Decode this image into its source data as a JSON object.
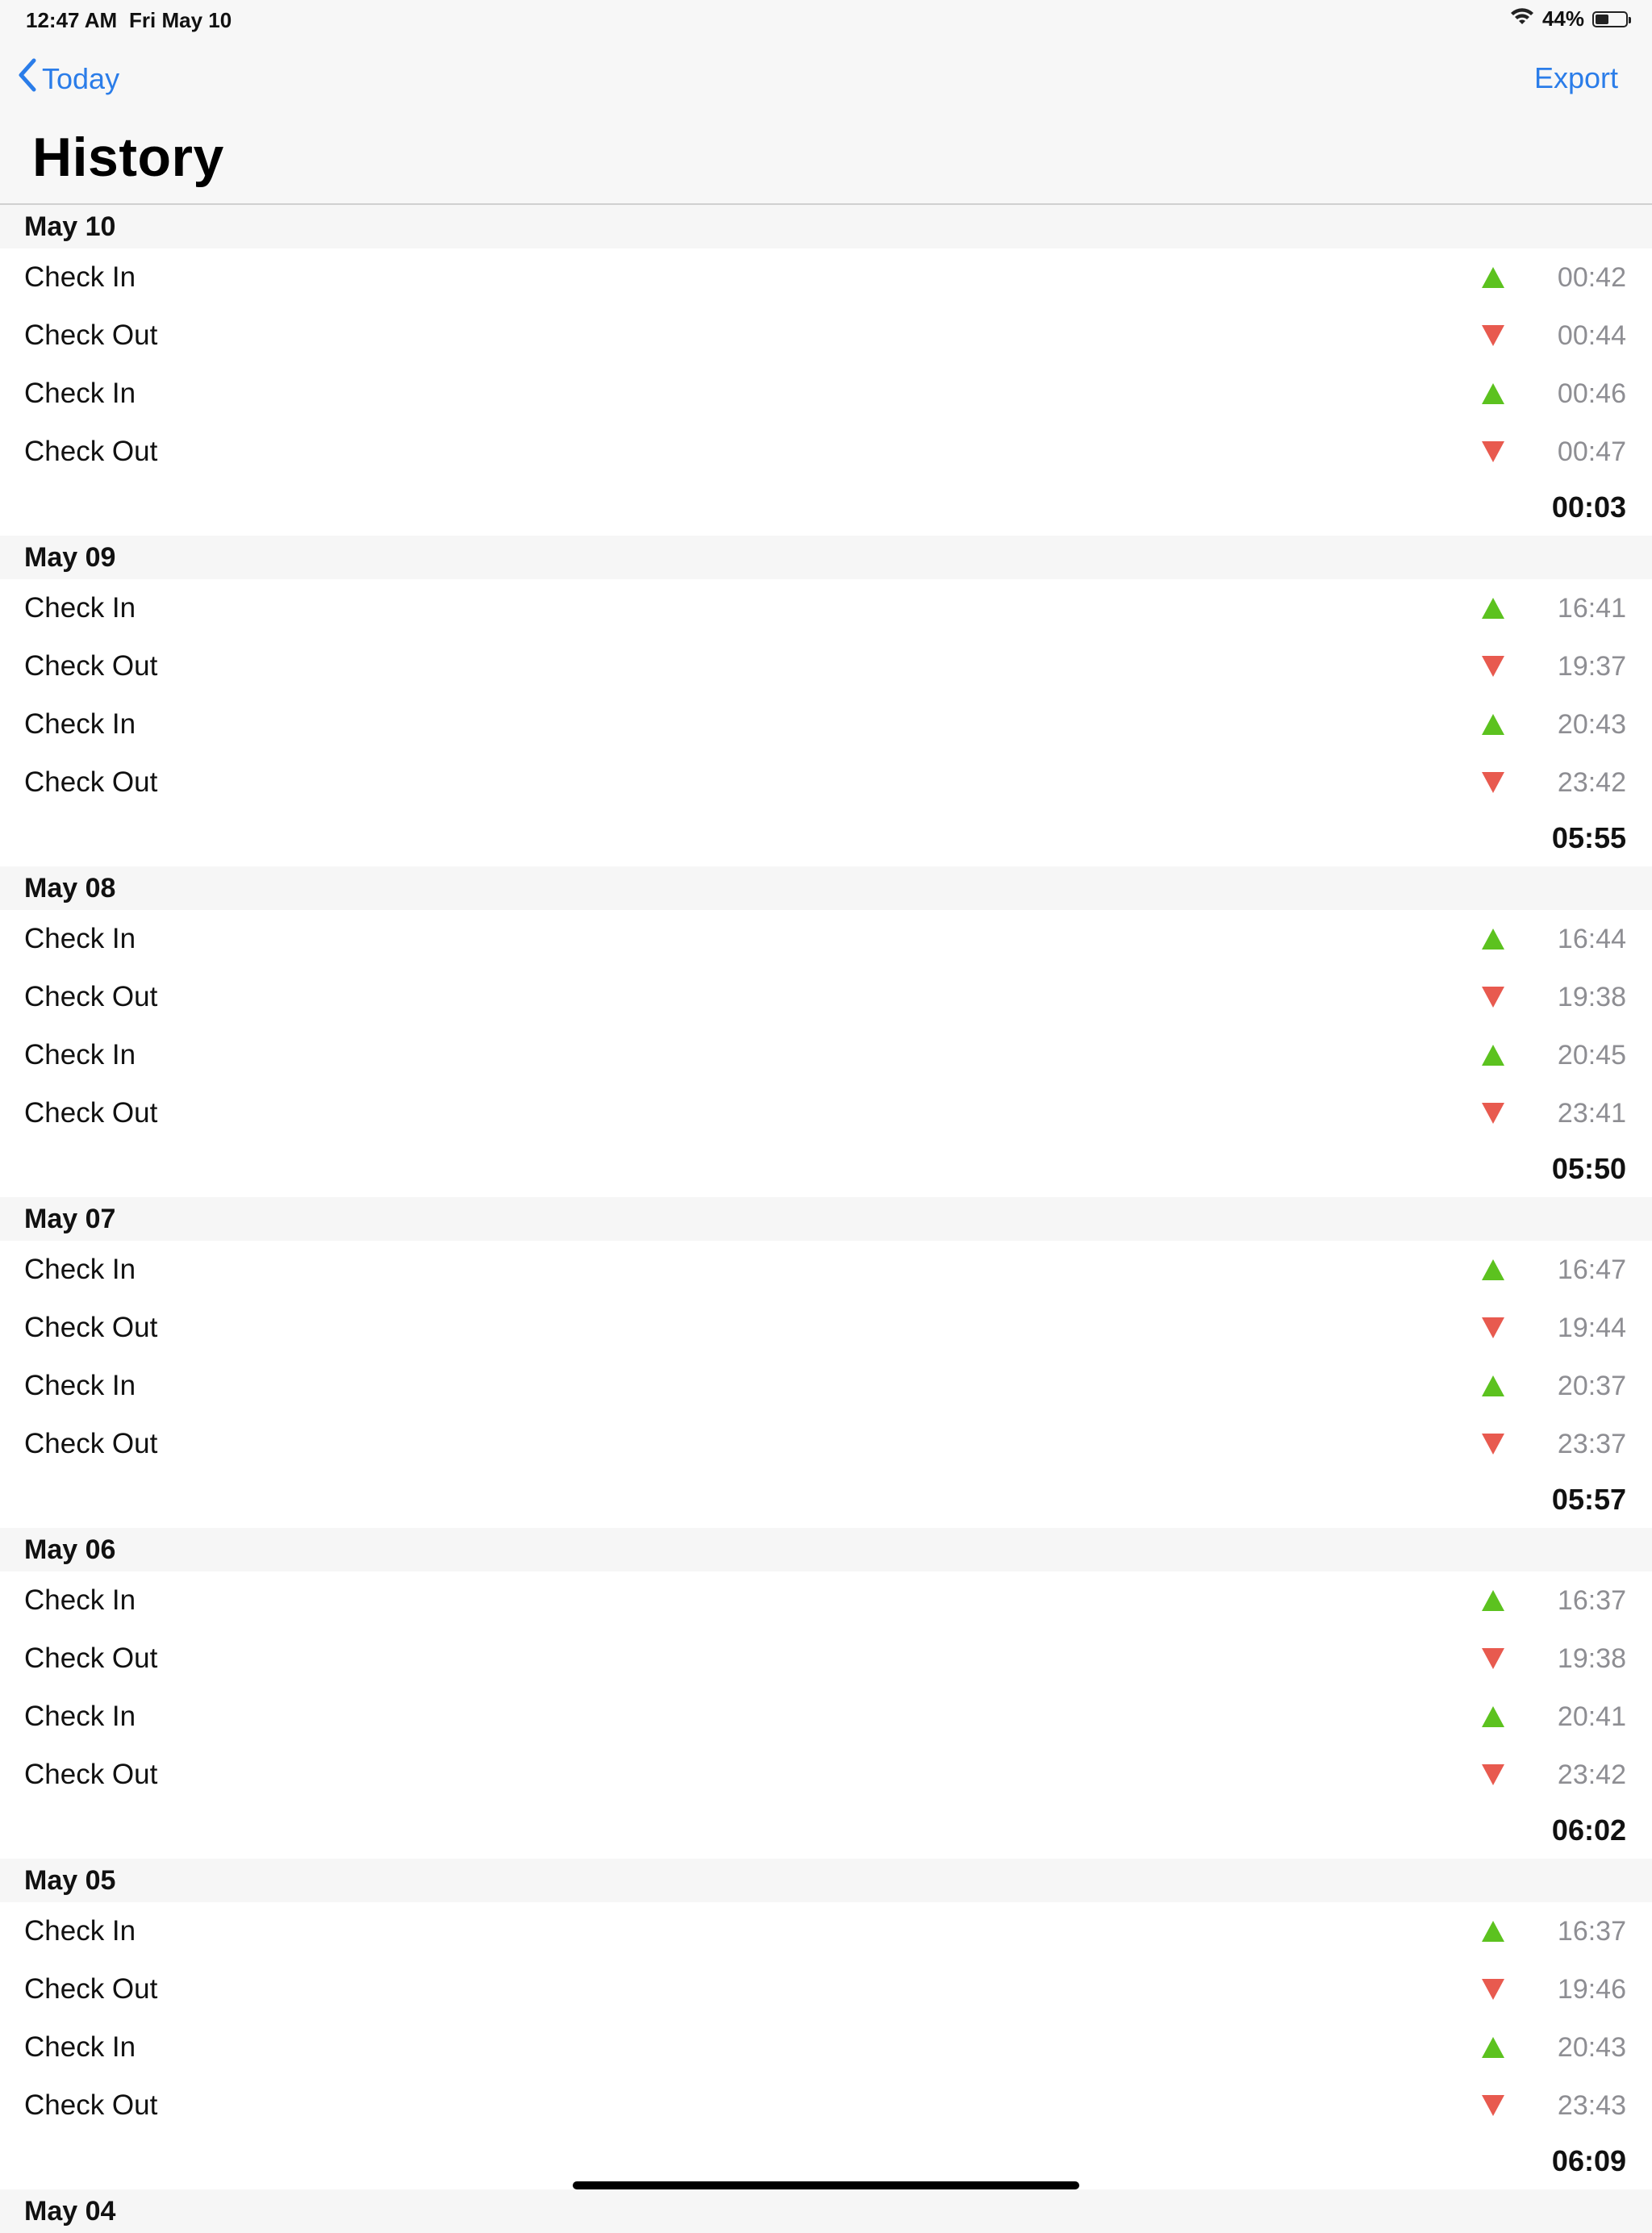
{
  "status_bar": {
    "time": "12:47 AM",
    "date": "Fri May 10",
    "battery_percent": "44%",
    "battery_level": 0.44
  },
  "nav": {
    "back_label": "Today",
    "action_label": "Export",
    "title": "History"
  },
  "colors": {
    "accent": "#2b7de9",
    "check_in": "#5cc21f",
    "check_out": "#e85a4f"
  },
  "sections": [
    {
      "date": "May 10",
      "entries": [
        {
          "label": "Check In",
          "type": "in",
          "time": "00:42"
        },
        {
          "label": "Check Out",
          "type": "out",
          "time": "00:44"
        },
        {
          "label": "Check In",
          "type": "in",
          "time": "00:46"
        },
        {
          "label": "Check Out",
          "type": "out",
          "time": "00:47"
        }
      ],
      "total": "00:03"
    },
    {
      "date": "May 09",
      "entries": [
        {
          "label": "Check In",
          "type": "in",
          "time": "16:41"
        },
        {
          "label": "Check Out",
          "type": "out",
          "time": "19:37"
        },
        {
          "label": "Check In",
          "type": "in",
          "time": "20:43"
        },
        {
          "label": "Check Out",
          "type": "out",
          "time": "23:42"
        }
      ],
      "total": "05:55"
    },
    {
      "date": "May 08",
      "entries": [
        {
          "label": "Check In",
          "type": "in",
          "time": "16:44"
        },
        {
          "label": "Check Out",
          "type": "out",
          "time": "19:38"
        },
        {
          "label": "Check In",
          "type": "in",
          "time": "20:45"
        },
        {
          "label": "Check Out",
          "type": "out",
          "time": "23:41"
        }
      ],
      "total": "05:50"
    },
    {
      "date": "May 07",
      "entries": [
        {
          "label": "Check In",
          "type": "in",
          "time": "16:47"
        },
        {
          "label": "Check Out",
          "type": "out",
          "time": "19:44"
        },
        {
          "label": "Check In",
          "type": "in",
          "time": "20:37"
        },
        {
          "label": "Check Out",
          "type": "out",
          "time": "23:37"
        }
      ],
      "total": "05:57"
    },
    {
      "date": "May 06",
      "entries": [
        {
          "label": "Check In",
          "type": "in",
          "time": "16:37"
        },
        {
          "label": "Check Out",
          "type": "out",
          "time": "19:38"
        },
        {
          "label": "Check In",
          "type": "in",
          "time": "20:41"
        },
        {
          "label": "Check Out",
          "type": "out",
          "time": "23:42"
        }
      ],
      "total": "06:02"
    },
    {
      "date": "May 05",
      "entries": [
        {
          "label": "Check In",
          "type": "in",
          "time": "16:37"
        },
        {
          "label": "Check Out",
          "type": "out",
          "time": "19:46"
        },
        {
          "label": "Check In",
          "type": "in",
          "time": "20:43"
        },
        {
          "label": "Check Out",
          "type": "out",
          "time": "23:43"
        }
      ],
      "total": "06:09"
    },
    {
      "date": "May 04",
      "entries": [],
      "total": ""
    }
  ]
}
